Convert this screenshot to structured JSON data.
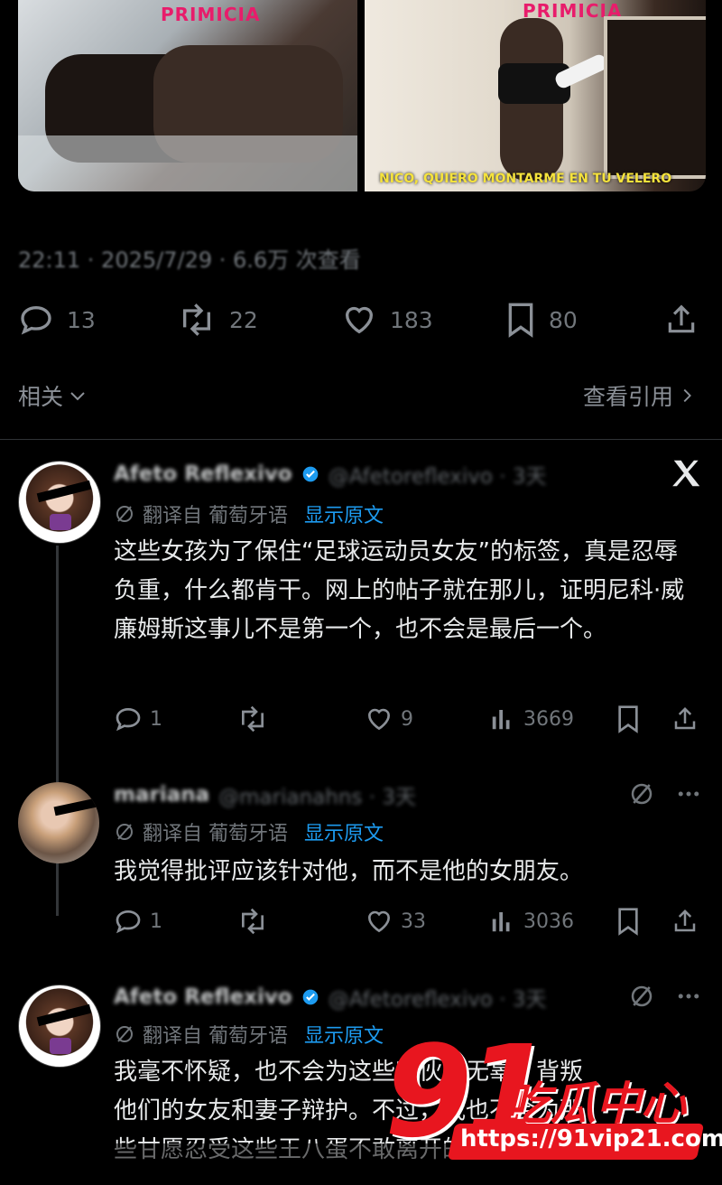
{
  "media": {
    "left_brand": "PRIMICIA",
    "right_brand": "PRIMICIA",
    "right_caption": "NICO, QUIERO MONTARME EN TU VELERO"
  },
  "tweet_meta": {
    "text": "22:11 · 2025/7/29 · 6.6万 次查看"
  },
  "stats": {
    "replies": "13",
    "retweets": "22",
    "likes": "183",
    "bookmarks": "80"
  },
  "related": {
    "left_label": "相关",
    "right_label": "查看引用"
  },
  "replies": [
    {
      "name": "Afeto Reflexivo",
      "handle": "@Afetoreflexivo · 3天",
      "translated_from": "翻译自 葡萄牙语",
      "show_original": "显示原文",
      "text": "这些女孩为了保住“足球运动员女友”的标签，真是忍辱负重，什么都肯干。网上的帖子就在那儿，证明尼科·威廉姆斯这事儿不是第一个，也不会是最后一个。",
      "reply_count": "1",
      "retweet_count": "",
      "like_count": "9",
      "view_count": "3669"
    },
    {
      "name": "mariana",
      "handle": "@marianahns · 3天",
      "translated_from": "翻译自 葡萄牙语",
      "show_original": "显示原文",
      "text": "我觉得批评应该针对他，而不是他的女朋友。",
      "reply_count": "1",
      "retweet_count": "",
      "like_count": "33",
      "view_count": "3036"
    },
    {
      "name": "Afeto Reflexivo",
      "handle": "@Afetoreflexivo · 3天",
      "translated_from": "翻译自 葡萄牙语",
      "show_original": "显示原文",
      "line1": "我毫不怀疑，也不会为这些家伙是无辜，背叛",
      "line2": "他们的女友和妻子辩护。不过，我也不会为那",
      "line3": "些甘愿忍受这些王八蛋不敢离开的女人开脱"
    }
  ],
  "watermark": {
    "big": "91",
    "brand": "吃瓜中心",
    "url": "https://91vip21.com"
  },
  "colors": {
    "background": "#000000",
    "link": "#1d9bf0",
    "muted": "#71767b",
    "watermark_red": "#e8161f"
  }
}
